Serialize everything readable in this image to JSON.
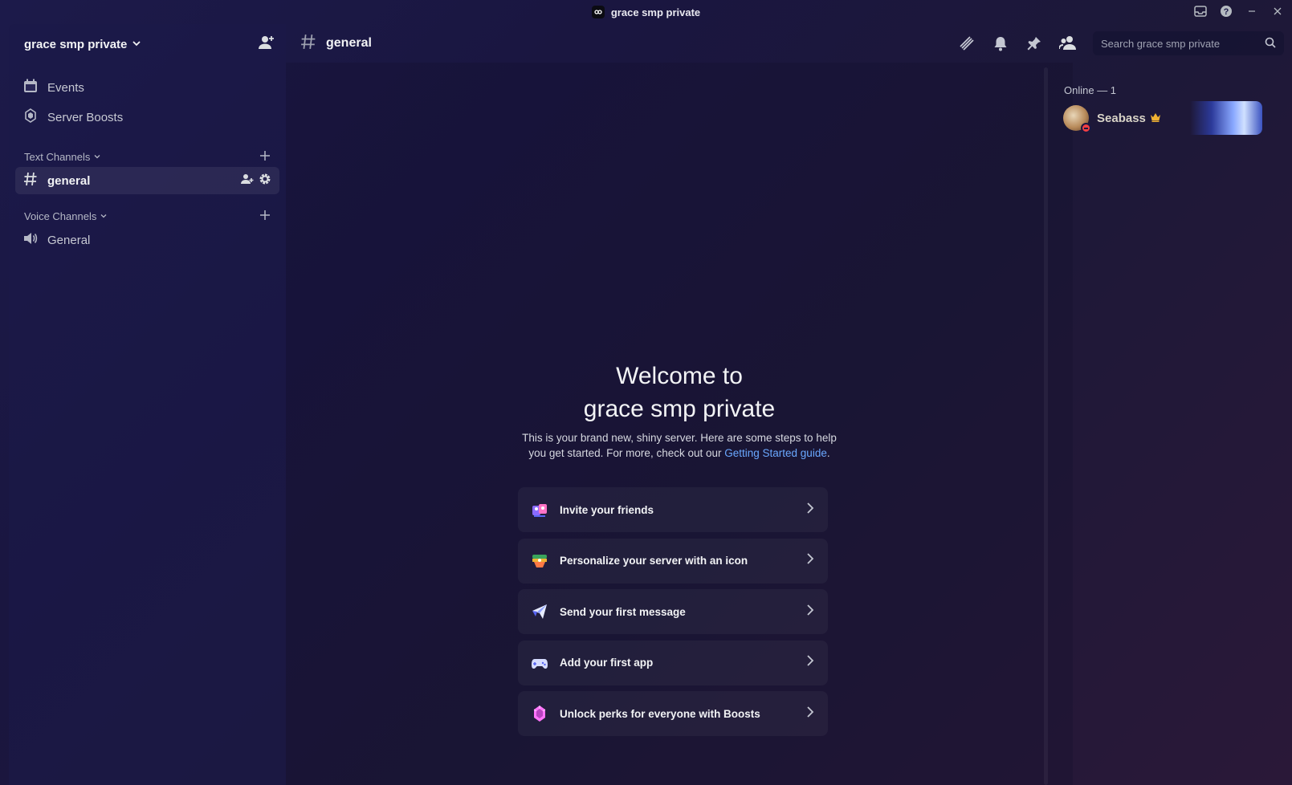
{
  "window": {
    "title": "grace smp private",
    "controls": [
      "inbox-icon",
      "help-icon",
      "minimize-icon",
      "close-icon"
    ]
  },
  "sidebar": {
    "server_name": "grace smp private",
    "top_items": [
      {
        "label": "Events",
        "icon": "calendar-icon"
      },
      {
        "label": "Server Boosts",
        "icon": "boost-icon"
      }
    ],
    "categories": [
      {
        "label": "Text Channels",
        "channels": [
          {
            "name": "general",
            "icon": "hash-icon",
            "active": true
          }
        ]
      },
      {
        "label": "Voice Channels",
        "channels": [
          {
            "name": "General",
            "icon": "speaker-icon",
            "active": false
          }
        ]
      }
    ]
  },
  "header": {
    "channel": "general",
    "search_placeholder": "Search grace smp private"
  },
  "welcome": {
    "title_line1": "Welcome to",
    "title_line2": "grace smp private",
    "description": "This is your brand new, shiny server. Here are some steps to help you get started. For more, check out our ",
    "link_text": "Getting Started guide",
    "after_link": "."
  },
  "steps": [
    {
      "label": "Invite your friends",
      "icon": "invite-friends-icon"
    },
    {
      "label": "Personalize your server with an icon",
      "icon": "personalize-icon"
    },
    {
      "label": "Send your first message",
      "icon": "paper-plane-icon"
    },
    {
      "label": "Add your first app",
      "icon": "gamepad-icon"
    },
    {
      "label": "Unlock perks for everyone with Boosts",
      "icon": "boost-gem-icon"
    }
  ],
  "members": {
    "heading": "Online — 1",
    "list": [
      {
        "name": "Seabass",
        "status": "dnd",
        "owner": true
      }
    ]
  },
  "colors": {
    "accent_link": "#6aa8ff",
    "dnd_status": "#f23f43",
    "owner_crown": "#f0b232"
  }
}
